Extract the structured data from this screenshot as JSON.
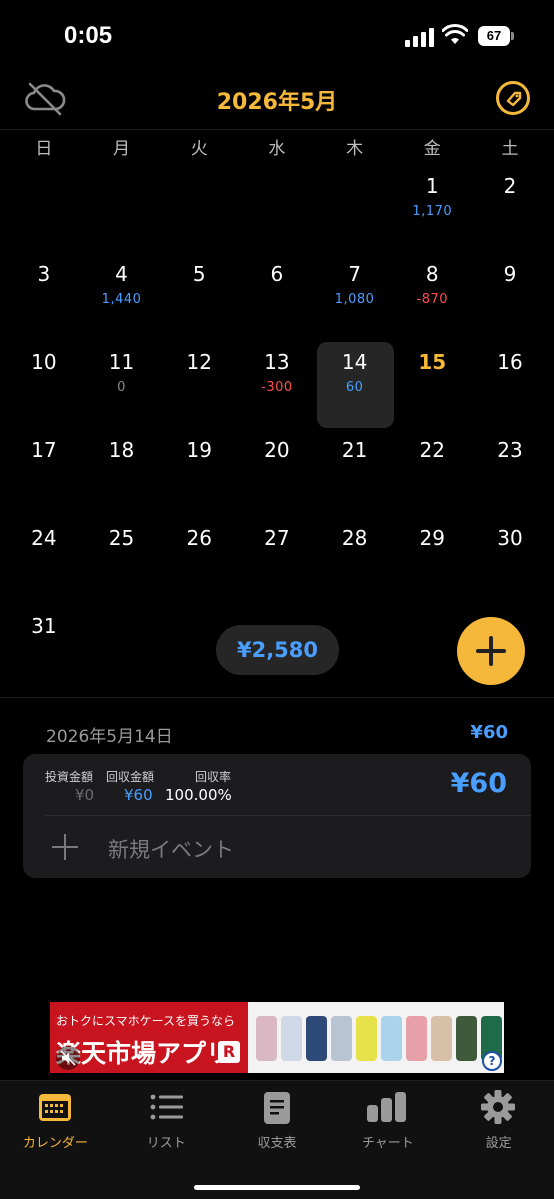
{
  "status_bar": {
    "time": "0:05",
    "battery": "67"
  },
  "header": {
    "title": "2026年5月",
    "left_icon": "cloud-off-icon",
    "right_icon": "tag-icon"
  },
  "weekdays": [
    "日",
    "月",
    "火",
    "水",
    "木",
    "金",
    "土"
  ],
  "calendar": {
    "weeks": [
      [
        {
          "d": ""
        },
        {
          "d": ""
        },
        {
          "d": ""
        },
        {
          "d": ""
        },
        {
          "d": ""
        },
        {
          "d": "1",
          "amt": "1,170",
          "tone": "pos"
        },
        {
          "d": "2"
        }
      ],
      [
        {
          "d": "3"
        },
        {
          "d": "4",
          "amt": "1,440",
          "tone": "pos"
        },
        {
          "d": "5"
        },
        {
          "d": "6"
        },
        {
          "d": "7",
          "amt": "1,080",
          "tone": "pos"
        },
        {
          "d": "8",
          "amt": "-870",
          "tone": "neg"
        },
        {
          "d": "9"
        }
      ],
      [
        {
          "d": "10"
        },
        {
          "d": "11",
          "amt": "0",
          "tone": "zero"
        },
        {
          "d": "12"
        },
        {
          "d": "13",
          "amt": "-300",
          "tone": "neg"
        },
        {
          "d": "14",
          "amt": "60",
          "tone": "pos",
          "selected": true
        },
        {
          "d": "15",
          "today": true
        },
        {
          "d": "16"
        }
      ],
      [
        {
          "d": "17"
        },
        {
          "d": "18"
        },
        {
          "d": "19"
        },
        {
          "d": "20"
        },
        {
          "d": "21"
        },
        {
          "d": "22"
        },
        {
          "d": "23"
        }
      ],
      [
        {
          "d": "24"
        },
        {
          "d": "25"
        },
        {
          "d": "26"
        },
        {
          "d": "27"
        },
        {
          "d": "28"
        },
        {
          "d": "29"
        },
        {
          "d": "30"
        }
      ],
      [
        {
          "d": "31"
        },
        {
          "d": ""
        },
        {
          "d": ""
        },
        {
          "d": ""
        },
        {
          "d": ""
        },
        {
          "d": ""
        },
        {
          "d": ""
        }
      ]
    ],
    "month_total": "¥2,580"
  },
  "colors": {
    "accent": "#f6b83a",
    "positive": "#4a9eff",
    "negative": "#ff4d4d",
    "zero": "#8a8a8a"
  },
  "detail": {
    "date": "2026年5月14日",
    "day_total": "¥60",
    "card": {
      "label_invest": "投資金額",
      "label_return": "回収金額",
      "label_rate": "回収率",
      "invest": "¥0",
      "return": "¥60",
      "rate": "100.00%",
      "amount": "¥60"
    },
    "new_event_label": "新規イベント"
  },
  "ad": {
    "top_text": "おトクにスマホケースを買うなら",
    "main_text": "楽天市場アプリ",
    "badge": "R",
    "help": "?"
  },
  "tabbar": [
    {
      "label": "カレンダー",
      "icon": "calendar-icon",
      "active": true
    },
    {
      "label": "リスト",
      "icon": "list-icon"
    },
    {
      "label": "収支表",
      "icon": "document-icon"
    },
    {
      "label": "チャート",
      "icon": "bar-chart-icon"
    },
    {
      "label": "設定",
      "icon": "gear-icon"
    }
  ]
}
